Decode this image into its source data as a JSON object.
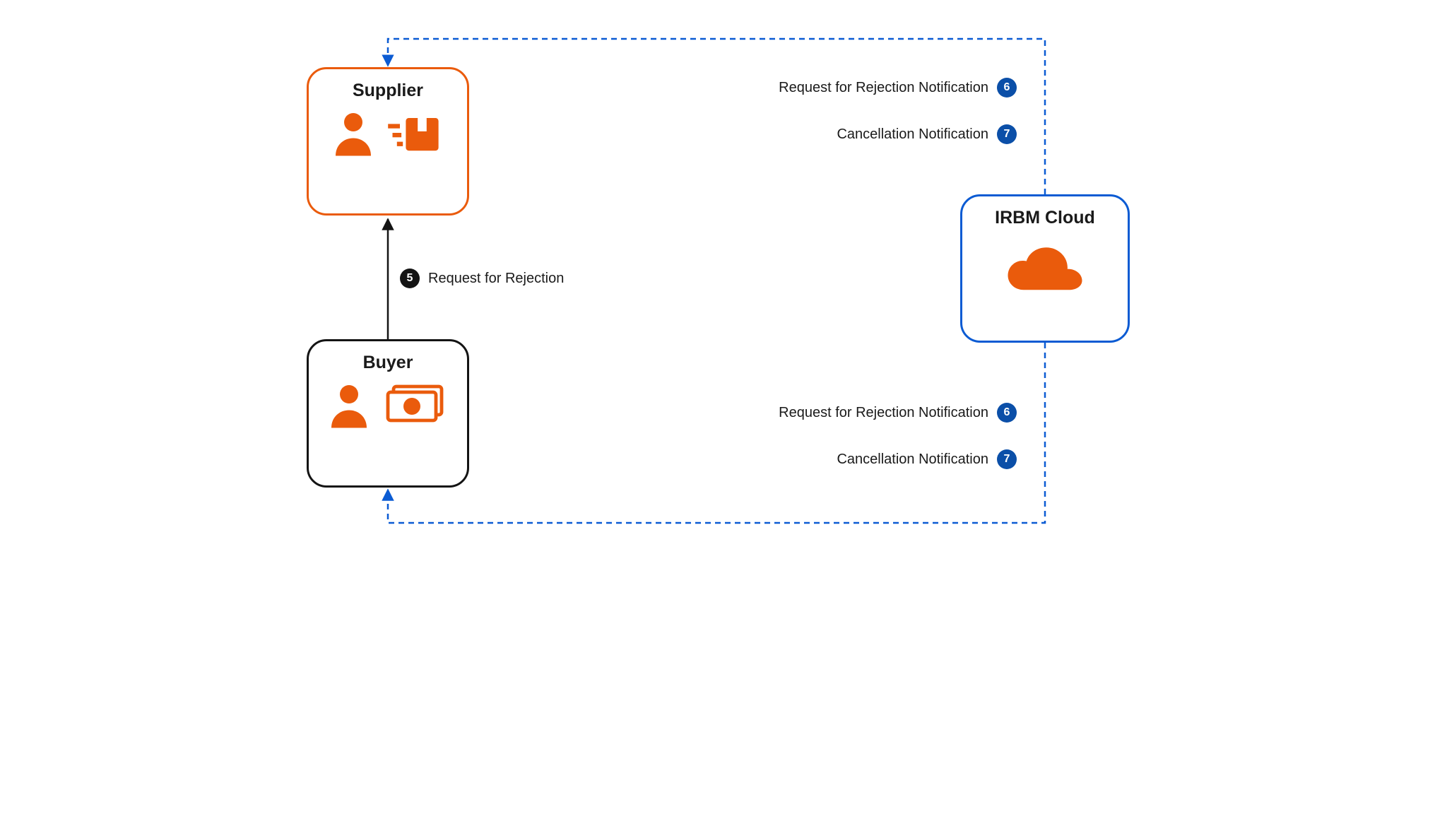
{
  "colors": {
    "orange": "#ea5b0c",
    "blue": "#0b5bd3",
    "navy": "#0b4fa8",
    "black": "#141414"
  },
  "nodes": {
    "supplier": {
      "title": "Supplier"
    },
    "buyer": {
      "title": "Buyer"
    },
    "cloud": {
      "title": "IRBM Cloud"
    }
  },
  "edges": {
    "buyer_to_supplier": {
      "badge": "5",
      "label": "Request for Rejection"
    }
  },
  "notifications_top": [
    {
      "label": "Request for Rejection Notification",
      "badge": "6"
    },
    {
      "label": "Cancellation Notification",
      "badge": "7"
    }
  ],
  "notifications_bottom": [
    {
      "label": "Request for Rejection Notification",
      "badge": "6"
    },
    {
      "label": "Cancellation Notification",
      "badge": "7"
    }
  ]
}
